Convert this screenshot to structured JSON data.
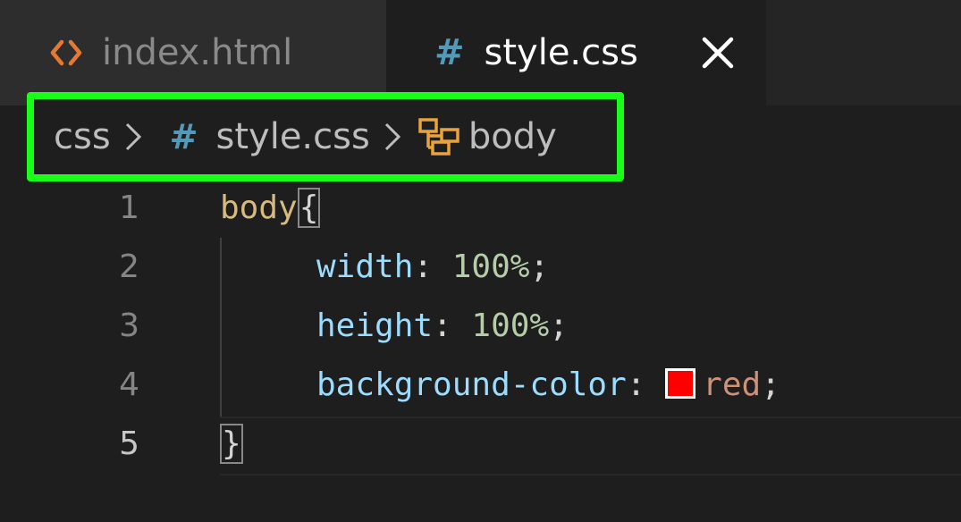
{
  "tabs": [
    {
      "label": "index.html",
      "icon": "html-icon",
      "active": false
    },
    {
      "label": "style.css",
      "icon": "css-hash-icon",
      "active": true
    }
  ],
  "breadcrumb": {
    "items": [
      "css",
      "style.css",
      "body"
    ],
    "highlight_color": "#1aff1a"
  },
  "editor": {
    "lines": [
      {
        "number": "1",
        "code": [
          "body",
          "{"
        ]
      },
      {
        "number": "2",
        "code": [
          "width",
          ":",
          "100%",
          ";"
        ]
      },
      {
        "number": "3",
        "code": [
          "height",
          ":",
          "100%",
          ";"
        ]
      },
      {
        "number": "4",
        "code": [
          "background-color",
          ":",
          "red",
          ";"
        ]
      },
      {
        "number": "5",
        "code": [
          "}"
        ]
      }
    ],
    "current_line": "5",
    "swatch_color": "#ff0000"
  }
}
